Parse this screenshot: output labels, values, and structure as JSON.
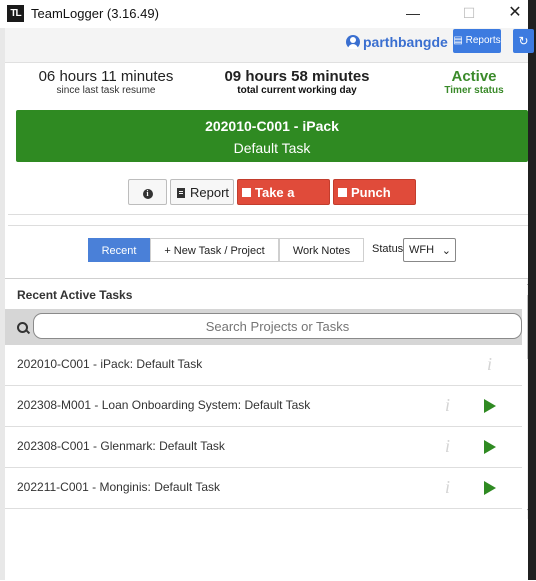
{
  "window": {
    "title": "TeamLogger (3.16.49)",
    "logo_text": "TL",
    "minimize_glyph": "—",
    "maximize_glyph": "☐",
    "close_glyph": "✕"
  },
  "header": {
    "username": "parthbangde",
    "reports_label": "Reports",
    "refresh_glyph": "↻"
  },
  "stats": [
    {
      "value": "06 hours 11 minutes",
      "label": "since last task resume"
    },
    {
      "value": "09 hours 58 minutes",
      "label": "total current working day"
    },
    {
      "value": "Active",
      "label": "Timer status"
    }
  ],
  "current_task": {
    "code": "202010-C001 - iPack",
    "name": "Default Task",
    "color": "#2f8a22"
  },
  "actions": {
    "report_label": "Report",
    "break_label": "Take a break",
    "punch_label": "Punch Out",
    "danger_color": "#e04b3a"
  },
  "tabs": [
    {
      "label": "Recent",
      "active": true
    },
    {
      "label": "+ New Task / Project",
      "active": false
    },
    {
      "label": "Work Notes",
      "active": false
    }
  ],
  "status": {
    "label": "Status",
    "selected": "WFH"
  },
  "task_list": {
    "heading": "Recent Active Tasks",
    "search_placeholder": "Search Projects or Tasks",
    "rows": [
      {
        "label": "202010-C001 - iPack: Default Task",
        "has_play": false
      },
      {
        "label": "202308-M001 - Loan Onboarding System: Default Task",
        "has_play": true
      },
      {
        "label": "202308-C001 - Glenmark: Default Task",
        "has_play": true
      },
      {
        "label": "202211-C001 - Monginis: Default Task",
        "has_play": true
      }
    ]
  },
  "colors": {
    "accent": "#3d7be0",
    "active_green": "#3a8a2a"
  }
}
